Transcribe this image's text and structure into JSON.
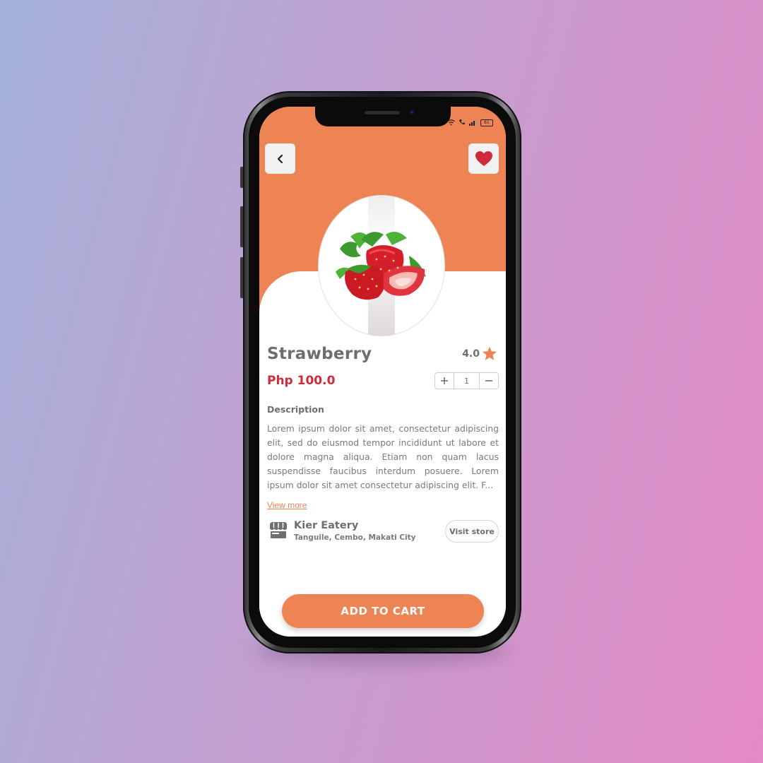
{
  "status_bar": {
    "battery": "61"
  },
  "product": {
    "name": "Strawberry",
    "rating": "4.0",
    "price": "Php 100.0",
    "quantity": "1",
    "image_icon": "strawberry-image"
  },
  "description": {
    "heading": "Description",
    "text": "Lorem ipsum dolor sit amet, consectetur adipiscing elit, sed do eiusmod tempor incididunt ut labore et dolore magna aliqua. Etiam non quam lacus suspendisse faucibus interdum posuere. Lorem ipsum dolor sit amet consectetur adipiscing elit. F...",
    "view_more": "View more"
  },
  "store": {
    "name": "Kier Eatery",
    "address": "Tanguile, Cembo, Makati City",
    "visit_label": "Visit store",
    "icon": "store-icon"
  },
  "actions": {
    "add_to_cart": "ADD TO CART"
  },
  "colors": {
    "accent": "#ee8453",
    "price": "#d12a3a",
    "heart": "#d12a3a",
    "text": "#6e6e6e"
  }
}
